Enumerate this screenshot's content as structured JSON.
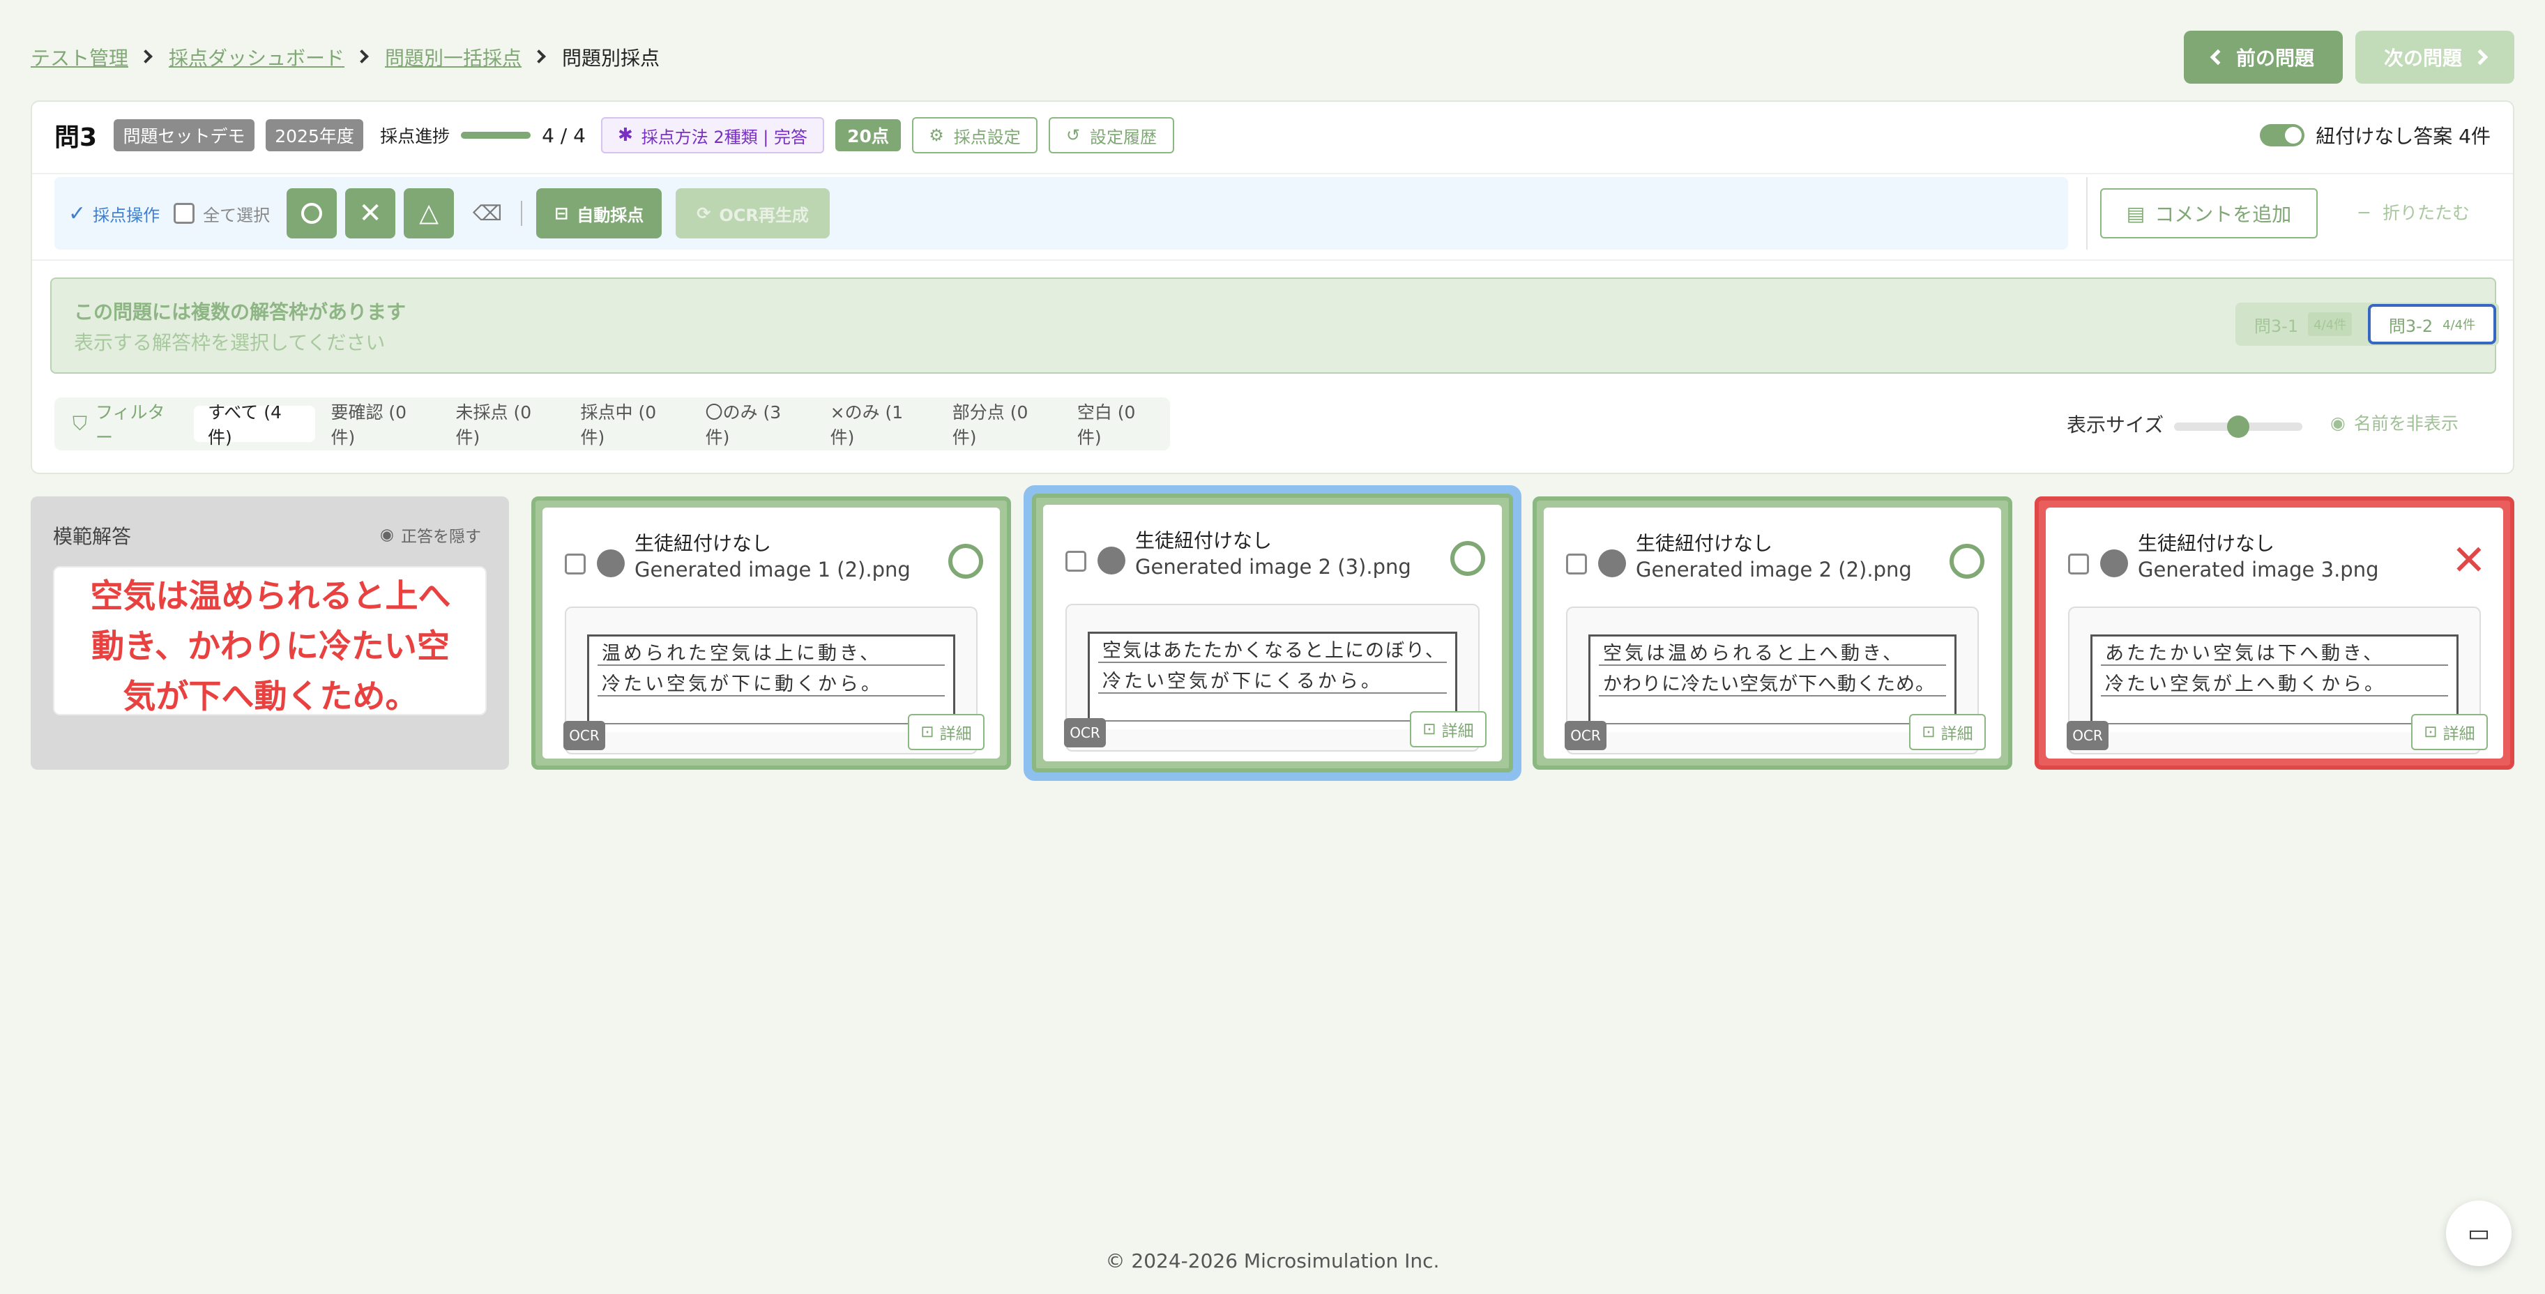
{
  "breadcrumb": {
    "items": [
      "テスト管理",
      "採点ダッシュボード",
      "問題別一括採点"
    ],
    "current": "問題別採点"
  },
  "nav": {
    "prev": "前の問題",
    "next": "次の問題"
  },
  "header": {
    "question": "問3",
    "tag_set": "問題セットデモ",
    "tag_year": "2025年度",
    "progress_label": "採点進捗",
    "progress_text": "4 / 4",
    "progress_fraction": 1.0,
    "method": "採点方法 2種類 | 完答",
    "points": "20点",
    "settings": "採点設定",
    "history": "設定履歴",
    "unlinked_toggle": "紐付けなし答案 4件"
  },
  "toolbar": {
    "ops_label": "採点操作",
    "select_all": "全て選択",
    "auto_grade": "自動採点",
    "ocr_regen": "OCR再生成",
    "add_comment": "コメントを追加",
    "collapse": "折りたたむ"
  },
  "notice": {
    "title": "この問題には複数の解答枠があります",
    "subtitle": "表示する解答枠を選択してください",
    "tabs": [
      {
        "label": "問3-1",
        "count": "4/4件"
      },
      {
        "label": "問3-2",
        "count": "4/4件"
      }
    ]
  },
  "filter": {
    "label": "フィルター",
    "items": [
      "すべて (4件)",
      "要確認 (0件)",
      "未採点 (0件)",
      "採点中 (0件)",
      "〇のみ (3件)",
      "×のみ (1件)",
      "部分点 (0件)",
      "空白 (0件)"
    ],
    "size_label": "表示サイズ",
    "size_value": 0.5,
    "hide_names": "名前を非表示"
  },
  "model_answer": {
    "title": "模範解答",
    "hide": "正答を隠す",
    "text": "空気は温められると上へ動き、かわりに冷たい空気が下へ動くため。"
  },
  "cards": [
    {
      "student": "生徒紐付けなし",
      "file": "Generated image 1 (2).png",
      "mark": "circle",
      "line1": "温められた空気は上に動き、",
      "line2": "冷たい空気が下に動くから。",
      "ocr": "OCR",
      "detail": "詳細"
    },
    {
      "student": "生徒紐付けなし",
      "file": "Generated image 2 (3).png",
      "mark": "circle",
      "line1": "空気はあたたかくなると上にのぼり、",
      "line2": "冷たい空気が下にくるから。",
      "ocr": "OCR",
      "detail": "詳細"
    },
    {
      "student": "生徒紐付けなし",
      "file": "Generated image 2 (2).png",
      "mark": "circle",
      "line1": "空気は温められると上へ動き、",
      "line2": "かわりに冷たい空気が下へ動くため。",
      "ocr": "OCR",
      "detail": "詳細"
    },
    {
      "student": "生徒紐付けなし",
      "file": "Generated image 3.png",
      "mark": "cross",
      "line1": "あたたかい空気は下へ動き、",
      "line2": "冷たい空気が上へ動くから。",
      "ocr": "OCR",
      "detail": "詳細"
    }
  ],
  "footer": "© 2024-2026 Microsimulation Inc.",
  "colors": {
    "accent": "#7fa874",
    "selected": "#8ec0ef",
    "wrong": "#e04848",
    "method": "#7a2fc4"
  }
}
